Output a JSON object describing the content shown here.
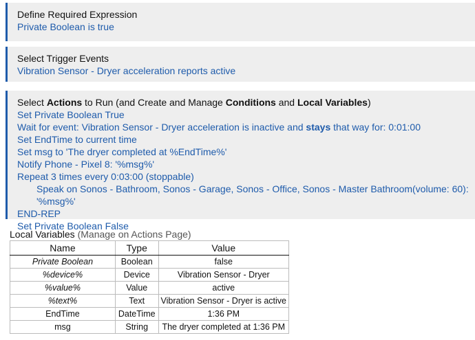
{
  "expression": {
    "title": "Define Required Expression",
    "value": "Private Boolean is true"
  },
  "trigger": {
    "title": "Select Trigger Events",
    "value": "Vibration Sensor - Dryer acceleration reports active"
  },
  "actions": {
    "title_prefix": "Select ",
    "title_actions": "Actions",
    "title_mid1": " to Run (and Create and Manage ",
    "title_conditions": "Conditions",
    "title_mid2": " and ",
    "title_locals": "Local Variables",
    "title_suffix": ")",
    "items": [
      "Set Private Boolean True",
      "Wait for event: Vibration Sensor - Dryer acceleration is inactive and ",
      "Set EndTime to current time",
      "Set msg to 'The dryer completed at %EndTime%'",
      "Notify Phone - Pixel 8: '%msg%'",
      "Repeat 3 times every 0:03:00 (stoppable)",
      "Speak on Sonos - Bathroom, Sonos - Garage, Sonos - Office, Sonos - Master Bathroom(volume: 60): '%msg%'",
      "END-REP",
      "Set Private Boolean False"
    ],
    "wait_bold": "stays",
    "wait_suffix": " that way for: 0:01:00"
  },
  "local_vars": {
    "title": "Local Variables",
    "manage": " (Manage on Actions Page)",
    "headers": [
      "Name",
      "Type",
      "Value"
    ],
    "rows": [
      {
        "name": "Private Boolean",
        "type": "Boolean",
        "value": "false"
      },
      {
        "name": "%device%",
        "type": "Device",
        "value": "Vibration Sensor - Dryer"
      },
      {
        "name": "%value%",
        "type": "Value",
        "value": "active"
      },
      {
        "name": "%text%",
        "type": "Text",
        "value": "Vibration Sensor - Dryer is active"
      },
      {
        "name": "EndTime",
        "type": "DateTime",
        "value": "1:36 PM"
      },
      {
        "name": "msg",
        "type": "String",
        "value": "The dryer completed at 1:36 PM"
      }
    ]
  },
  "colors": {
    "link": "#1e5bab",
    "panel_bg": "#eeeeee",
    "accent_border": "#1e5bab"
  }
}
